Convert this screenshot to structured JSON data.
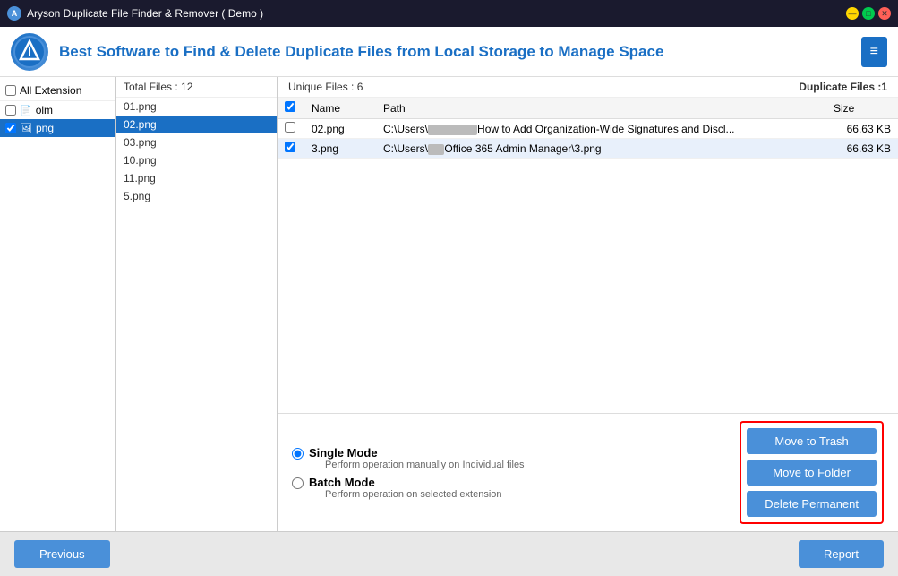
{
  "titlebar": {
    "title": "Aryson Duplicate File Finder & Remover ( Demo )",
    "btn_min": "—",
    "btn_max": "□",
    "btn_close": "✕"
  },
  "header": {
    "logo_text": "A",
    "title": "Best Software to Find & Delete Duplicate Files from Local Storage to Manage Space",
    "menu_icon": "≡"
  },
  "left_panel": {
    "all_extension_label": "All Extension",
    "items": [
      {
        "name": "olm",
        "checked": false,
        "selected": false
      },
      {
        "name": "png",
        "checked": true,
        "selected": true
      }
    ]
  },
  "middle_panel": {
    "header": "Total Files : 12",
    "files": [
      {
        "name": "01.png",
        "selected": false
      },
      {
        "name": "02.png",
        "selected": true
      },
      {
        "name": "03.png",
        "selected": false
      },
      {
        "name": "10.png",
        "selected": false
      },
      {
        "name": "11.png",
        "selected": false
      },
      {
        "name": "5.png",
        "selected": false
      }
    ]
  },
  "right_panel": {
    "unique_label": "Unique Files : 6",
    "duplicate_label": "Duplicate Files :1",
    "table": {
      "columns": [
        "",
        "Name",
        "Path",
        "Size"
      ],
      "rows": [
        {
          "checked": false,
          "name": "02.png",
          "path_prefix": "C:\\Users\\",
          "path_blurred": "                    ",
          "path_suffix": "How to Add Organization-Wide Signatures and Discl...",
          "size": "66.63 KB"
        },
        {
          "checked": true,
          "name": "3.png",
          "path_prefix": "C:\\Users\\",
          "path_blurred": "      ",
          "path_suffix": "Office 365 Admin Manager\\3.png",
          "size": "66.63 KB"
        }
      ]
    }
  },
  "bottom_action": {
    "single_mode_label": "Single Mode",
    "single_mode_desc": "Perform operation manually on Individual files",
    "batch_mode_label": "Batch Mode",
    "batch_mode_desc": "Perform operation on selected extension",
    "btn_move_trash": "Move to Trash",
    "btn_move_folder": "Move to Folder",
    "btn_delete_permanent": "Delete Permanent"
  },
  "footer": {
    "btn_previous": "Previous",
    "btn_report": "Report"
  }
}
